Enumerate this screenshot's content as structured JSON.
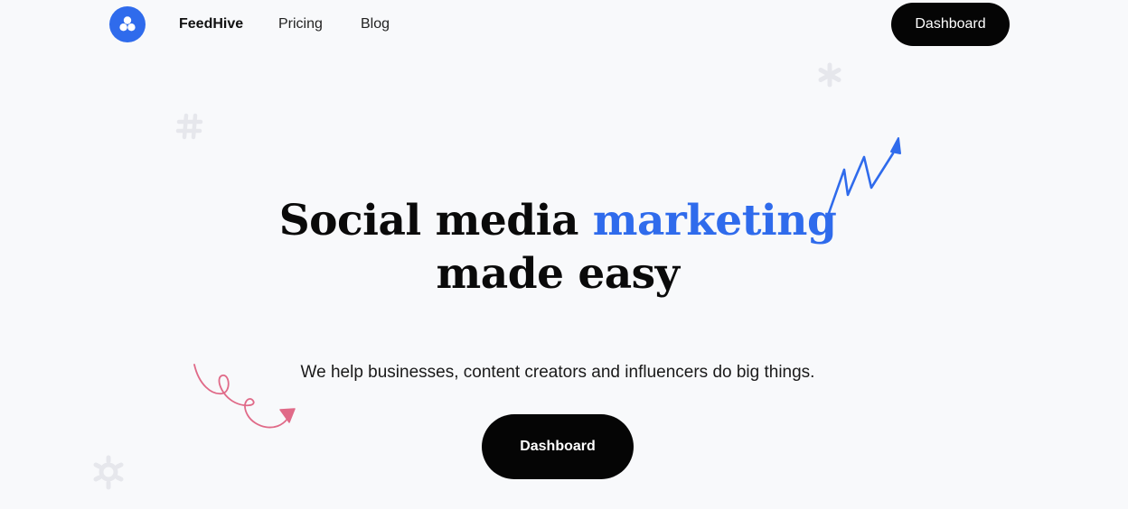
{
  "header": {
    "brand": "FeedHive",
    "logo_icon": "hexagon-cluster-icon",
    "nav": {
      "pricing": "Pricing",
      "blog": "Blog"
    },
    "cta_label": "Dashboard"
  },
  "hero": {
    "title_part1": "Social media ",
    "title_accent": "marketing",
    "title_line2": "made easy",
    "subtitle": "We help businesses, content creators and influencers do big things.",
    "cta_label": "Dashboard"
  },
  "decorations": {
    "hash_icon": "hashtag-icon",
    "asterisk_icon": "asterisk-icon",
    "gear_icon": "gear-icon",
    "chart_arrow_icon": "zigzag-arrow-icon",
    "curly_arrow_icon": "curly-arrow-icon"
  },
  "colors": {
    "accent": "#2f6bec",
    "pink": "#e06a88",
    "dark": "#050505",
    "background": "#f8f9fb",
    "faint": "#e8e9ee"
  }
}
